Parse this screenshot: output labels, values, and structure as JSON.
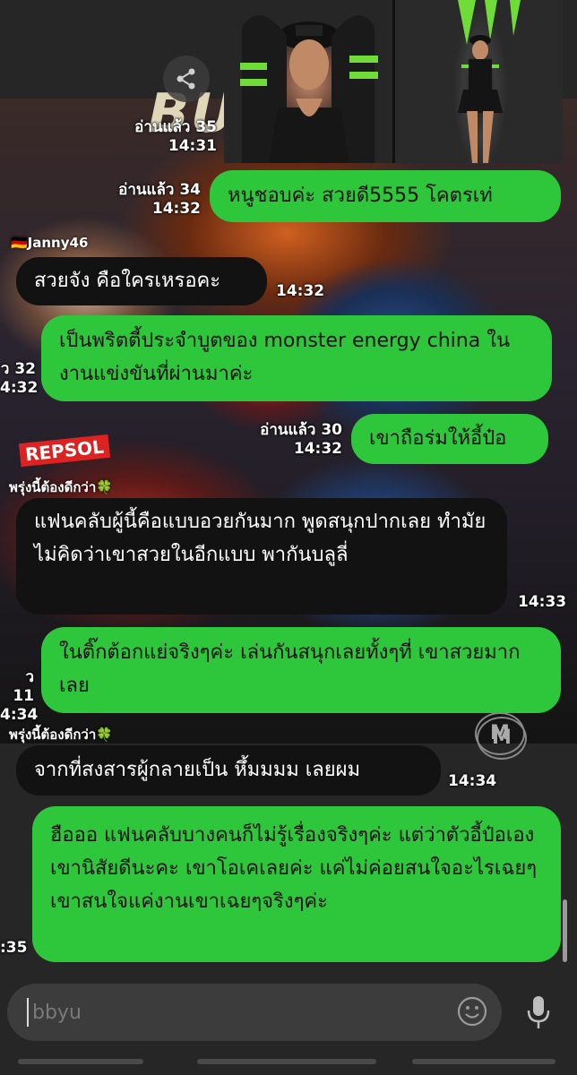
{
  "background": {
    "poster_text": "BU",
    "repsol_text": "REPSOL",
    "logo_text": "M"
  },
  "images": {
    "logo_text_1": "M",
    "logo_text_2": "M"
  },
  "messages": [
    {
      "id": "m1",
      "side": "right",
      "read": "อ่านแล้ว 35",
      "time": "14:31"
    },
    {
      "id": "m2",
      "side": "right",
      "read": "อ่านแล้ว 34",
      "time": "14:32",
      "text": "หนูชอบค่ะ สวยดี5555 โคตรเท่"
    },
    {
      "id": "m3",
      "side": "left",
      "sender": "🇩🇪Janny46",
      "time": "14:32",
      "text": "สวยจัง คือใครเหรอคะ"
    },
    {
      "id": "m4",
      "side": "right",
      "read": "ว 32",
      "time": "4:32",
      "text": "เป็นพริตตี้ประจำบูตของ monster energy china ในงานแข่งขันที่ผ่านมาค่ะ"
    },
    {
      "id": "m5",
      "side": "right",
      "read": "อ่านแล้ว 30",
      "time": "14:32",
      "text": "เขาถือร่มให้อี้ป๋อ"
    },
    {
      "id": "m6",
      "side": "left",
      "sender": "พรุ่งนี้ต้องดีกว่า🍀",
      "time": "14:33",
      "text": "แฟนคลับผู้นี้คือแบบอวยกันมาก พูดสนุกปากเลย ทำมัยไม่คิดว่าเขาสวยในอีกแบบ พากันบลูลี่"
    },
    {
      "id": "m7",
      "side": "right",
      "read": "ว 11",
      "time": "4:34",
      "text": "ในติ๊กต้อกแย่จริงๆค่ะ เล่นกันสนุกเลยทั้งๆที่ เขาสวยมากเลย"
    },
    {
      "id": "m8",
      "side": "left",
      "sender": "พรุ่งนี้ต้องดีกว่า🍀",
      "time": "14:34",
      "text": "จากที่สงสารผู้กลายเป็น หึ้มมมม เลยผม"
    },
    {
      "id": "m9",
      "side": "right",
      "time": ":35",
      "text": "ฮือออ แฟนคลับบางคนก็ไม่รู้เรื่องจริงๆค่ะ แต่ว่าตัวอี้ป๋อเองเขานิสัยดีนะคะ เขาโอเคเลยค่ะ แค่ไม่ค่อยสนใจอะไรเฉยๆ เขาสนใจแค่งานเขาเฉยๆจริงๆค่ะ"
    }
  ],
  "input": {
    "placeholder": "bbyu",
    "value": ""
  },
  "icons": {
    "share": "share-icon",
    "emoji": "emoji-icon",
    "mic": "microphone-icon"
  }
}
